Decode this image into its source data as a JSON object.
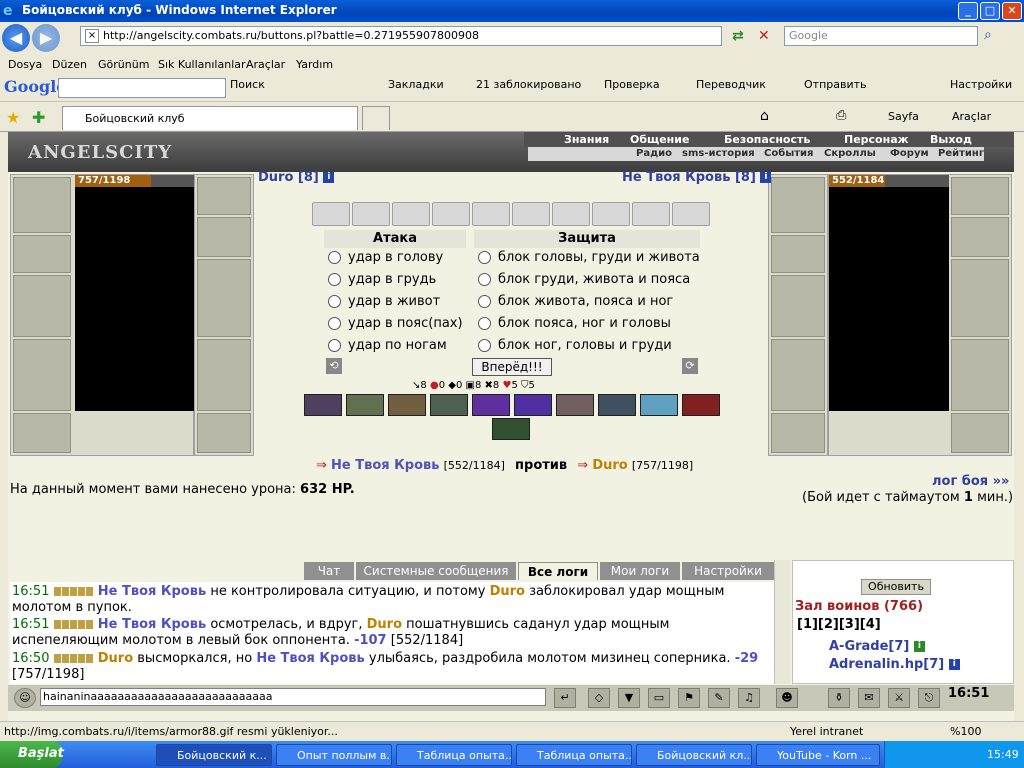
{
  "window": {
    "title": "Бойцовский клуб - Windows Internet Explorer",
    "min": "_",
    "max": "□",
    "close": "✕"
  },
  "address": {
    "url": "http://angelscity.combats.ru/buttons.pl?battle=0.271955907800908",
    "search_placeholder": "Google",
    "search_btn": "⌕"
  },
  "menu": [
    "Dosya",
    "Düzen",
    "Görünüm",
    "Sık Kullanılanlar",
    "Araçlar",
    "Yardım"
  ],
  "gtoolbar": {
    "logo": "Google",
    "search_label": "Поиск",
    "bookmarks": "Закладки",
    "blocked": "21 заблокировано",
    "check": "Проверка",
    "translate": "Переводчик",
    "send": "Отправить",
    "settings": "Настройки"
  },
  "tabs": {
    "active": "Бойцовский клуб",
    "page": "Sayfa",
    "tools": "Araçlar"
  },
  "site": {
    "logo": "ANGELSCITY",
    "nav1": [
      "Знания",
      "Общение",
      "Безопасность",
      "Персонаж",
      "Выход"
    ],
    "nav2": [
      "Радио",
      "sms-история",
      "События",
      "Скроллы",
      "Форум",
      "Рейтинг"
    ]
  },
  "player1": {
    "name": "Duro [8]",
    "hp_text": "757/1198",
    "hp": 757,
    "hp_max": 1198
  },
  "player2": {
    "name": "Не Твоя Кровь [8]",
    "hp_text": "552/1184",
    "hp": 552,
    "hp_max": 1184
  },
  "attack": {
    "header": "Атака",
    "options": [
      "удар в голову",
      "удар в грудь",
      "удар в живот",
      "удар в пояс(пах)",
      "удар по ногам"
    ]
  },
  "defense": {
    "header": "Защита",
    "options": [
      "блок головы, груди и живота",
      "блок груди, живота и пояса",
      "блок живота, пояса и ног",
      "блок пояса, ног и головы",
      "блок ног, головы и груди"
    ]
  },
  "go_button": "Вперёд!!!",
  "stats": [
    "8",
    "0",
    "0",
    "8",
    "8",
    "5",
    "5"
  ],
  "versus": {
    "p2": "Не Твоя Кровь",
    "p2hp": "[552/1184]",
    "vs": "против",
    "p1": "Duro",
    "p1hp": "[757/1198]"
  },
  "damage": {
    "text": "На данный момент вами нанесено урона:",
    "value": "632 HP."
  },
  "log_link": "лог боя »»",
  "timeout": {
    "pre": "(Бой идет с таймаутом",
    "val": "1",
    "post": "мин.)"
  },
  "chat_tabs": [
    "Чат",
    "Системные сообщения",
    "Все логи",
    "Мои логи",
    "Настройки"
  ],
  "chat": [
    {
      "time": "16:51",
      "a": "Не Твоя Кровь",
      "t1": " не контролировала ситуацию, и потому ",
      "b": "Duro",
      "t2": " заблокировал удар мощным",
      "t3": "молотом в пупок."
    },
    {
      "time": "16:51",
      "a": "Не Твоя Кровь",
      "t1": " осмотрелась, и вдруг, ",
      "b": "Duro",
      "t2": " пошатнувшись саданул удар мощным",
      "t3": "испепеляющим молотом в левый бок оппонента. ",
      "dmg": "-107",
      "hp": " [552/1184]"
    },
    {
      "time": "16:50",
      "a": "Duro",
      "t1": " высморкался, но ",
      "b": "Не Твоя Кровь",
      "t2": " улыбаясь, раздробила молотом мизинец соперника. ",
      "dmg": "-29",
      "hp": "[757/1198]"
    }
  ],
  "side": {
    "refresh": "Обновить",
    "hall": "Зал воинов (766)",
    "pages": "[1][2][3][4]",
    "warriors": [
      "A-Grade[7]",
      "Adrenalin.hp[7]"
    ]
  },
  "chat_input": "hainaninaaaaaaaaaaaaaaaaaaaaaaaaaaa",
  "clock": "16:51",
  "status": {
    "text": "http://img.combats.ru/i/items/armor88.gif resmi yükleniyor...",
    "zone": "Yerel intranet",
    "zoom": "%100"
  },
  "taskbar": {
    "start": "Başlat",
    "tasks": [
      "Бойцовский к...",
      "Опыт поллым в...",
      "Таблица опыта...",
      "Таблица опыта...",
      "Бойцовский кл...",
      "YouTube - Korn ..."
    ],
    "time": "15:49"
  }
}
